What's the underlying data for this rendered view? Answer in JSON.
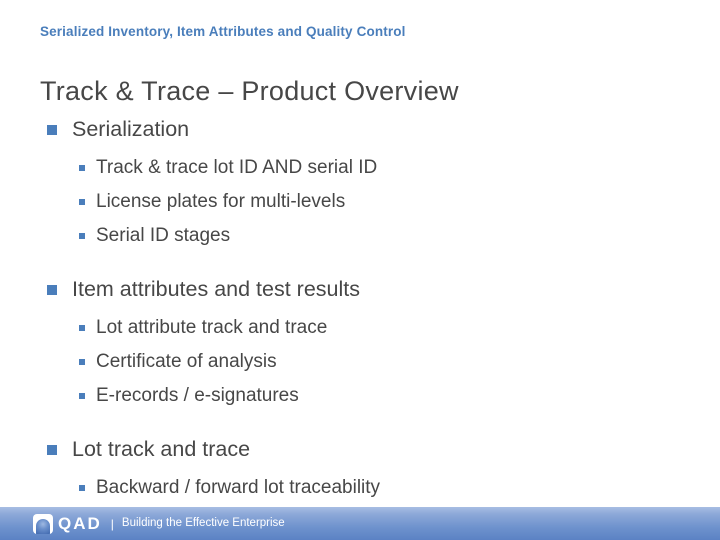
{
  "slide": {
    "kicker": "Serialized Inventory, Item Attributes and Quality Control",
    "title": "Track & Trace – Product Overview",
    "colors": {
      "accent_blue": "#4A7EBB",
      "text_gray": "#474747",
      "footer_gradient_top": "#A8BDE3",
      "footer_gradient_bottom": "#5B82C4"
    },
    "groups": [
      {
        "heading": "Serialization",
        "items": [
          "Track & trace lot ID AND serial ID",
          "License plates for multi-levels",
          "Serial ID stages"
        ]
      },
      {
        "heading": "Item attributes and test results",
        "items": [
          "Lot attribute track and trace",
          "Certificate of analysis",
          "E-records / e-signatures"
        ]
      },
      {
        "heading": "Lot track and trace",
        "items": [
          "Backward / forward lot traceability"
        ]
      }
    ]
  },
  "footer": {
    "logo_text": "QAD",
    "separator": "|",
    "tagline": "Building the Effective Enterprise"
  }
}
